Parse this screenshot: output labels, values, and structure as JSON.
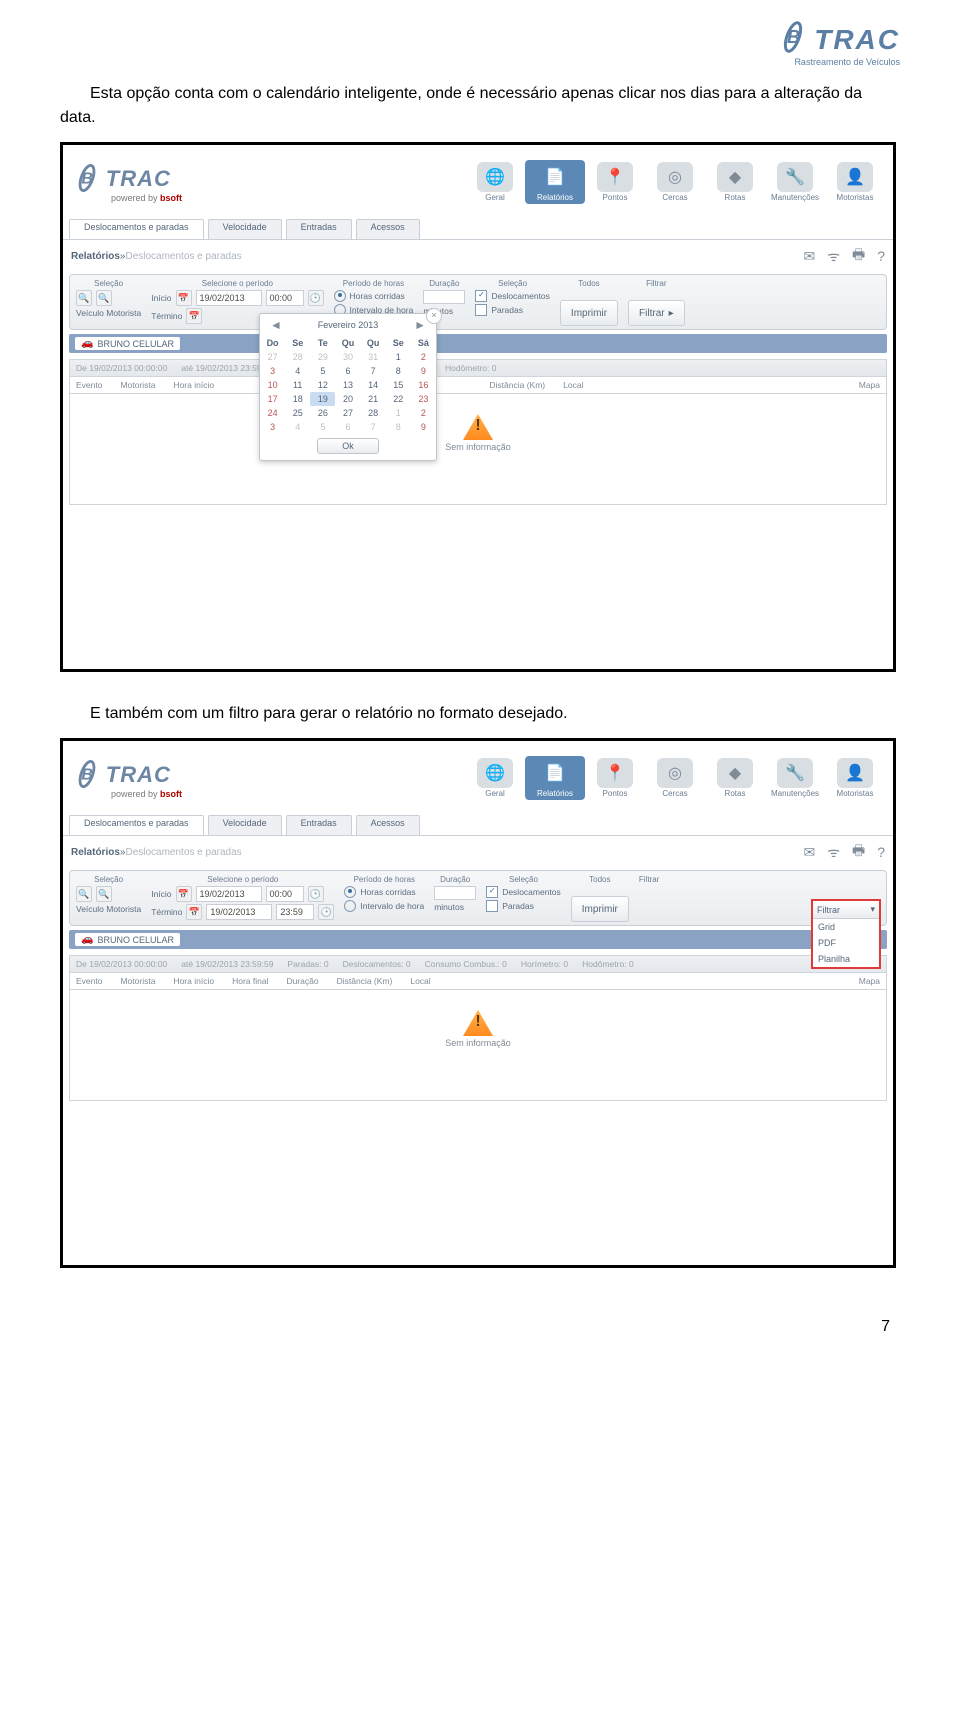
{
  "header": {
    "brand": "TRAC",
    "tagline": "Rastreamento de Veículos"
  },
  "para1": "Esta opção conta com o calendário inteligente, onde é necessário apenas clicar nos dias para a alteração da data.",
  "para2": "E também com um filtro para gerar o relatório no formato desejado.",
  "page_number": "7",
  "app": {
    "brand": "TRAC",
    "powered_prefix": "powered by ",
    "powered_brand": "bsoft",
    "nav": [
      "Geral",
      "Relatórios",
      "Pontos",
      "Cercas",
      "Rotas",
      "Manutenções",
      "Motoristas"
    ],
    "nav_active_index": 1,
    "subtabs": [
      "Deslocamentos e paradas",
      "Velocidade",
      "Entradas",
      "Acessos"
    ],
    "crumb_root": "Relatórios",
    "crumb_sep": " » ",
    "crumb_leaf": "Deslocamentos e paradas",
    "toolbar": {
      "g_selecao": "Seleção",
      "selecao_opts": "Veículo  Motorista",
      "g_periodo_title": "Selecione o período",
      "lbl_inicio": "Início",
      "lbl_termino": "Término",
      "date_value": "19/02/2013",
      "time_start": "00:00",
      "time_end": "23:59",
      "g_periodo_horas": "Período de horas",
      "horas_corridas": "Horas corridas",
      "intervalo": "Intervalo de hora",
      "g_duracao": "Duração",
      "minutos": "minutos",
      "g_selecao2": "Seleção",
      "desloc": "Deslocamentos",
      "paradas": "Paradas",
      "g_todos": "Todos",
      "btn_imprimir": "Imprimir",
      "g_filtrar": "Filtrar",
      "btn_filtrar": "Filtrar"
    },
    "vehicle_chip": "BRUNO CELULAR",
    "summary": {
      "de": "De",
      "de_val": "19/02/2013 00:00:00",
      "ate": "até",
      "ate_val": "19/02/2013 23:59:59",
      "paradas": "Paradas:",
      "paradas_val": "0",
      "desloc": "Deslocamentos:",
      "desloc_val": "0",
      "consumo": "Consumo Combus.:",
      "consumo_val": "0",
      "horimetro": "Horímetro:",
      "horimetro_val": "0",
      "hodometro": "Hodômetro:",
      "hodometro_val": "0"
    },
    "cols": [
      "Evento",
      "Motorista",
      "Hora início",
      "Hora final",
      "Duração",
      "Distância (Km)",
      "Local",
      "Mapa"
    ],
    "no_info": "Sem informação"
  },
  "calendar": {
    "title": "Fevereiro 2013",
    "wk": [
      "Do",
      "Se",
      "Te",
      "Qu",
      "Qu",
      "Se",
      "Sá"
    ],
    "rows": [
      [
        {
          "v": "27",
          "off": true
        },
        {
          "v": "28",
          "off": true
        },
        {
          "v": "29",
          "off": true
        },
        {
          "v": "30",
          "off": true
        },
        {
          "v": "31",
          "off": true
        },
        {
          "v": "1"
        },
        {
          "v": "2",
          "we": true
        }
      ],
      [
        {
          "v": "3",
          "we": true
        },
        {
          "v": "4"
        },
        {
          "v": "5"
        },
        {
          "v": "6"
        },
        {
          "v": "7"
        },
        {
          "v": "8"
        },
        {
          "v": "9",
          "we": true
        }
      ],
      [
        {
          "v": "10",
          "we": true
        },
        {
          "v": "11"
        },
        {
          "v": "12"
        },
        {
          "v": "13"
        },
        {
          "v": "14"
        },
        {
          "v": "15"
        },
        {
          "v": "16",
          "we": true
        }
      ],
      [
        {
          "v": "17",
          "we": true
        },
        {
          "v": "18"
        },
        {
          "v": "19",
          "today": true
        },
        {
          "v": "20"
        },
        {
          "v": "21"
        },
        {
          "v": "22"
        },
        {
          "v": "23",
          "we": true
        }
      ],
      [
        {
          "v": "24",
          "we": true
        },
        {
          "v": "25"
        },
        {
          "v": "26"
        },
        {
          "v": "27"
        },
        {
          "v": "28"
        },
        {
          "v": "1",
          "off": true
        },
        {
          "v": "2",
          "off": true,
          "we": true
        }
      ],
      [
        {
          "v": "3",
          "off": true,
          "we": true
        },
        {
          "v": "4",
          "off": true
        },
        {
          "v": "5",
          "off": true
        },
        {
          "v": "6",
          "off": true
        },
        {
          "v": "7",
          "off": true
        },
        {
          "v": "8",
          "off": true
        },
        {
          "v": "9",
          "off": true,
          "we": true
        }
      ]
    ],
    "ok": "Ok"
  },
  "filter_dd": {
    "button": "Filtrar",
    "items": [
      "Grid",
      "PDF",
      "Planilha"
    ]
  }
}
